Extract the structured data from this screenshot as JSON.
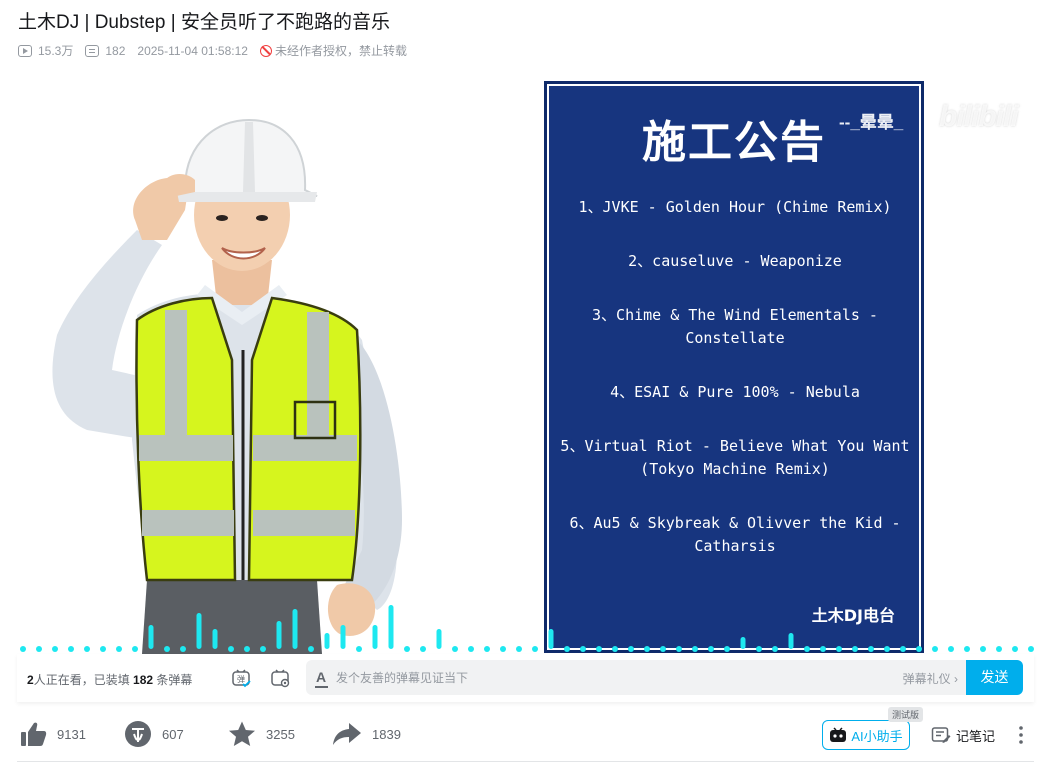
{
  "video": {
    "title": "土木DJ | Dubstep | 安全员听了不跑路的音乐",
    "views": "15.3万",
    "danmaku_count": "182",
    "publish_time": "2025-11-04 01:58:12",
    "copyright_notice": "未经作者授权，禁止转载"
  },
  "overlay": {
    "notice_title": "施工公告",
    "tracks": [
      "1、JVKE - Golden Hour (Chime Remix)",
      "2、causeluve - Weaponize",
      "3、Chime & The Wind Elementals - Constellate",
      "4、ESAI & Pure 100% - Nebula",
      "5、Virtual Riot - Believe What You Want (Tokyo Machine Remix)",
      "6、Au5 & Skybreak & Olivver the Kid - Catharsis"
    ],
    "station": "土木DJ电台",
    "uploader_watermark": "--_晕晕_",
    "logo_watermark": "bilibili"
  },
  "danmaku_bar": {
    "online_count": "2",
    "online_text_a": "人正在看，已装填 ",
    "loaded_count": "182",
    "online_text_b": " 条弹幕",
    "input_placeholder": "发个友善的弹幕见证当下",
    "etiquette_label": "弹幕礼仪 ›",
    "send_label": "发送"
  },
  "toolbar": {
    "like_count": "9131",
    "coin_count": "607",
    "favorite_count": "3255",
    "share_count": "1839",
    "ai_label": "AI小助手",
    "ai_badge": "测试版",
    "note_label": "记笔记"
  },
  "colors": {
    "accent": "#00aeec",
    "notice_bg": "#17357f",
    "visualizer": "#1ee8f0",
    "vest": "#d6f51e"
  },
  "icons": [
    "play-count-icon",
    "danmaku-count-icon",
    "no-repost-icon",
    "danmaku-toggle-icon",
    "danmaku-settings-icon",
    "like-icon",
    "coin-icon",
    "favorite-icon",
    "share-icon",
    "ai-robot-icon",
    "note-icon",
    "more-icon"
  ]
}
